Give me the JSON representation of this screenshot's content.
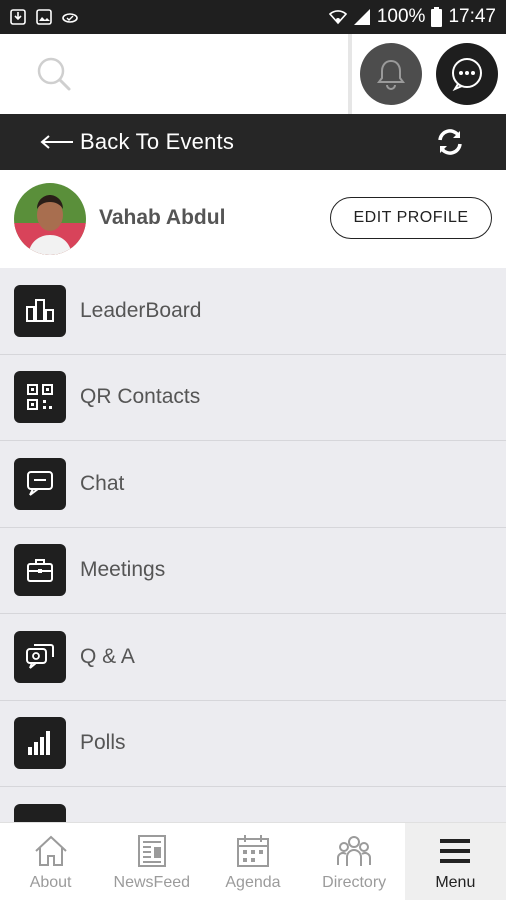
{
  "status_bar": {
    "battery": "100%",
    "time": "17:47"
  },
  "header": {
    "search_icon": "search-icon",
    "notifications_icon": "bell-icon",
    "messages_icon": "chat-bubble-icon"
  },
  "back_bar": {
    "label": "Back To Events",
    "refresh_icon": "refresh-icon"
  },
  "profile": {
    "name": "Vahab Abdul",
    "edit_label": "EDIT PROFILE"
  },
  "menu": {
    "items": [
      {
        "label": "LeaderBoard",
        "icon": "leaderboard-icon"
      },
      {
        "label": "QR Contacts",
        "icon": "qr-code-icon"
      },
      {
        "label": "Chat",
        "icon": "chat-icon"
      },
      {
        "label": "Meetings",
        "icon": "briefcase-icon"
      },
      {
        "label": "Q & A",
        "icon": "qa-icon"
      },
      {
        "label": "Polls",
        "icon": "bar-chart-icon"
      }
    ]
  },
  "bottom_nav": {
    "items": [
      {
        "label": "About",
        "icon": "home-icon"
      },
      {
        "label": "NewsFeed",
        "icon": "newspaper-icon"
      },
      {
        "label": "Agenda",
        "icon": "calendar-icon"
      },
      {
        "label": "Directory",
        "icon": "people-icon"
      },
      {
        "label": "Menu",
        "icon": "hamburger-icon"
      }
    ],
    "active": "Menu"
  },
  "colors": {
    "dark_bar": "#262626",
    "list_background": "#ececf0",
    "icon_tile": "#1f1f1f",
    "muted_text": "#555555"
  }
}
